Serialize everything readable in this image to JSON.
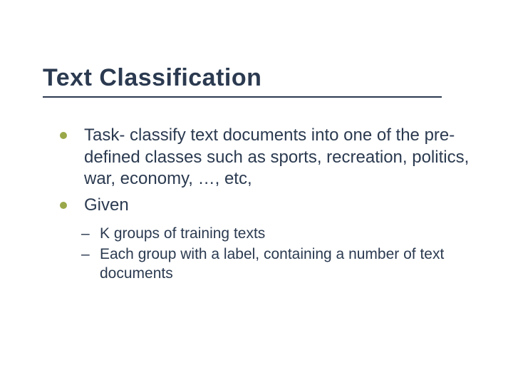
{
  "slide": {
    "title": "Text Classification",
    "bullets": [
      {
        "text": "Task- classify text documents into one of the pre-defined classes such as sports, recreation, politics, war, economy, …, etc,"
      },
      {
        "text": "Given"
      }
    ],
    "subbullets": [
      {
        "text": "K groups of training texts"
      },
      {
        "text": "Each group with a label, containing a number of text documents"
      }
    ]
  }
}
